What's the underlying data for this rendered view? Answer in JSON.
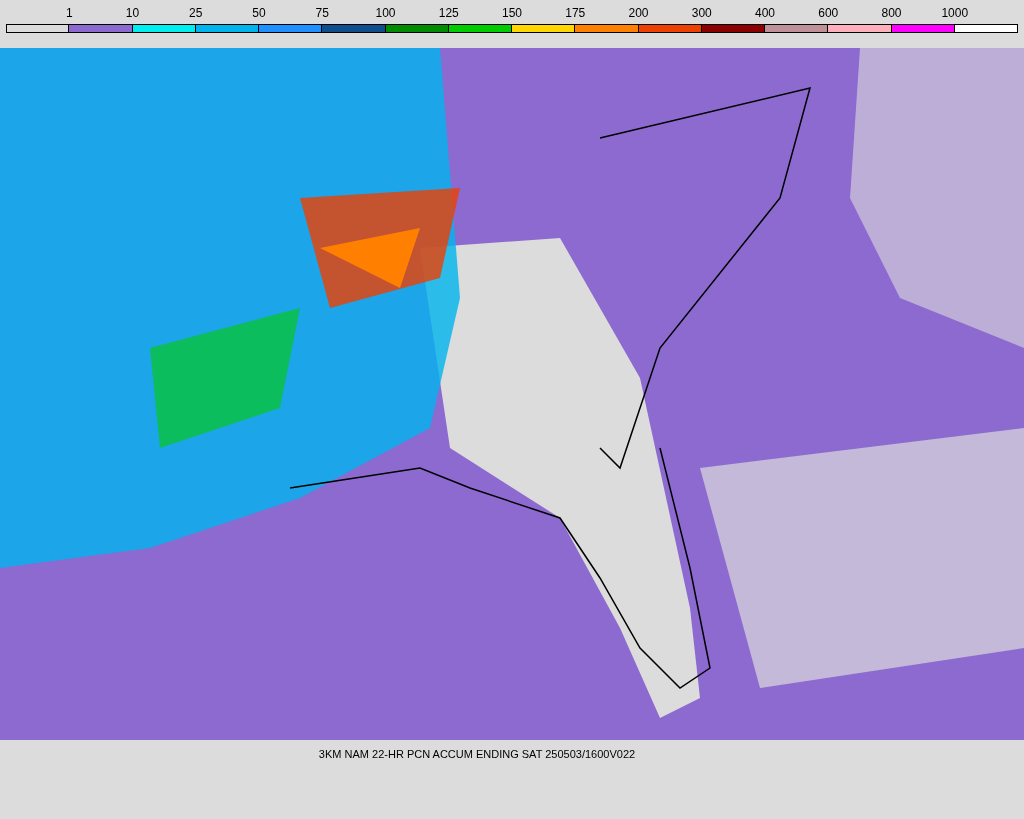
{
  "legend": {
    "bins": [
      {
        "color": "#dcdcdc",
        "label": "1"
      },
      {
        "color": "#8c6ad0",
        "label": "10"
      },
      {
        "color": "#00eeee",
        "label": "25"
      },
      {
        "color": "#00b4ee",
        "label": "50"
      },
      {
        "color": "#1e90ff",
        "label": "75"
      },
      {
        "color": "#104e8b",
        "label": "100"
      },
      {
        "color": "#008b00",
        "label": "125"
      },
      {
        "color": "#00cd00",
        "label": "150"
      },
      {
        "color": "#ffd700",
        "label": "175"
      },
      {
        "color": "#ff7f00",
        "label": "200"
      },
      {
        "color": "#ee4000",
        "label": "300"
      },
      {
        "color": "#8b0000",
        "label": "400"
      },
      {
        "color": "#c09098",
        "label": "600"
      },
      {
        "color": "#ffaebb",
        "label": "800"
      },
      {
        "color": "#ff00ff",
        "label": "1000"
      },
      {
        "color": "#ffffff"
      }
    ]
  },
  "caption": "3KM NAM 22-HR PCN ACCUM ENDING SAT 250503/1600V022"
}
